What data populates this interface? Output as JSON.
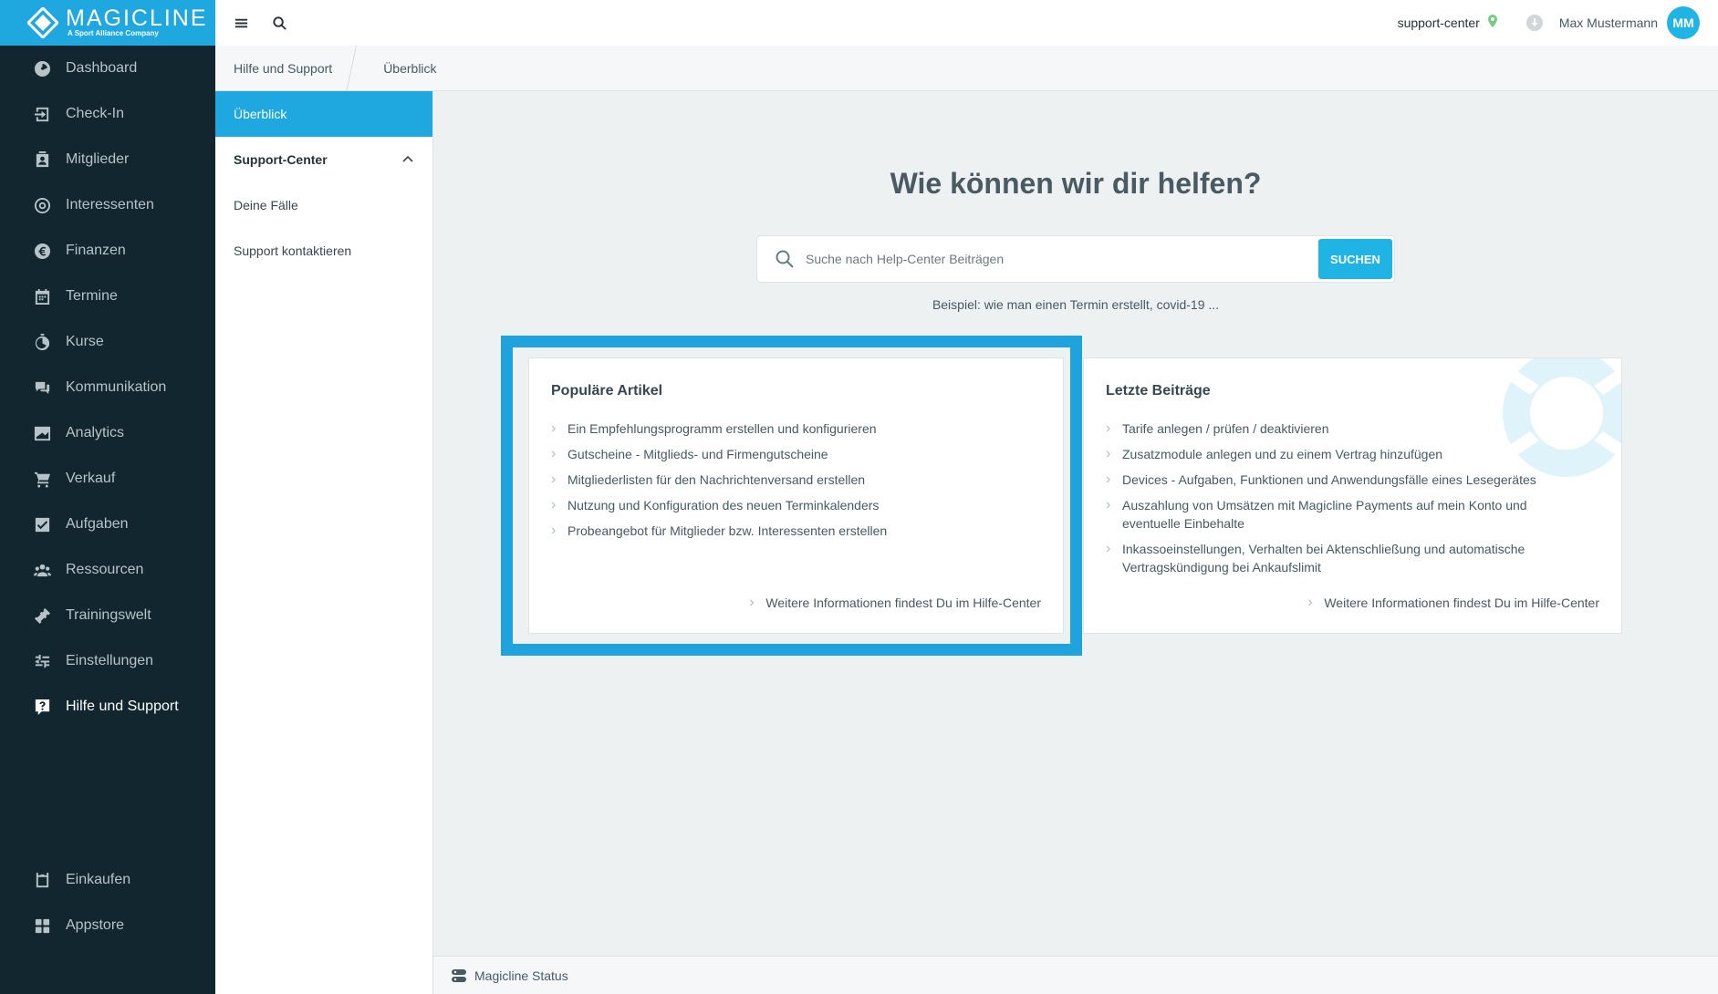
{
  "app": {
    "brand": "MAGICLINE",
    "brand_sub": "A Sport Alliance Company"
  },
  "sidebar": {
    "items": [
      {
        "label": "Dashboard",
        "icon": "dashboard-icon"
      },
      {
        "label": "Check-In",
        "icon": "check-in-icon"
      },
      {
        "label": "Mitglieder",
        "icon": "members-icon"
      },
      {
        "label": "Interessenten",
        "icon": "leads-icon"
      },
      {
        "label": "Finanzen",
        "icon": "euro-icon"
      },
      {
        "label": "Termine",
        "icon": "calendar-icon"
      },
      {
        "label": "Kurse",
        "icon": "stopwatch-icon"
      },
      {
        "label": "Kommunikation",
        "icon": "chat-icon"
      },
      {
        "label": "Analytics",
        "icon": "chart-icon"
      },
      {
        "label": "Verkauf",
        "icon": "cart-icon"
      },
      {
        "label": "Aufgaben",
        "icon": "task-icon"
      },
      {
        "label": "Ressourcen",
        "icon": "people-icon"
      },
      {
        "label": "Trainingswelt",
        "icon": "dumbbell-icon"
      },
      {
        "label": "Einstellungen",
        "icon": "sliders-icon"
      },
      {
        "label": "Hilfe und Support",
        "icon": "help-icon",
        "active": true
      }
    ],
    "bottom_items": [
      {
        "label": "Einkaufen",
        "icon": "shop-icon"
      },
      {
        "label": "Appstore",
        "icon": "apps-icon"
      }
    ]
  },
  "topbar": {
    "studio": "support-center",
    "user": "Max Mustermann",
    "avatar_initials": "MM"
  },
  "breadcrumb": [
    "Hilfe und Support",
    "Überblick"
  ],
  "subnav": {
    "overview": "Überblick",
    "group": "Support-Center",
    "cases": "Deine Fälle",
    "contact": "Support kontaktieren"
  },
  "main": {
    "title": "Wie können wir dir helfen?",
    "search_placeholder": "Suche nach Help-Center Beiträgen",
    "search_button": "SUCHEN",
    "hint": "Beispiel: wie man einen Termin erstellt, covid-19 ..."
  },
  "popular": {
    "title": "Populäre Artikel",
    "items": [
      "Ein Empfehlungsprogramm erstellen und konfigurieren",
      "Gutscheine - Mitglieds- und Firmengutscheine",
      "Mitgliederlisten für den Nachrichtenversand erstellen",
      "Nutzung und Konfiguration des neuen Terminkalenders",
      "Probeangebot für Mitglieder bzw. Interessenten erstellen"
    ],
    "more": "Weitere Informationen findest Du im Hilfe-Center"
  },
  "recent": {
    "title": "Letzte Beiträge",
    "items": [
      "Tarife anlegen / prüfen / deaktivieren",
      "Zusatzmodule anlegen und zu einem Vertrag hinzufügen",
      "Devices - Aufgaben, Funktionen und Anwendungsfälle eines Lesegerätes",
      "Auszahlung von Umsätzen mit Magicline Payments auf mein Konto und eventuelle Einbehalte",
      "Inkassoeinstellungen, Verhalten bei Aktenschließung und automatische Vertragskündigung bei Ankaufslimit"
    ],
    "more": "Weitere Informationen findest Du im Hilfe-Center"
  },
  "footer": {
    "status": "Magicline Status"
  },
  "colors": {
    "accent": "#1fa8df",
    "sidebar_bg": "#12262f",
    "highlight": "#1fa3dc"
  }
}
